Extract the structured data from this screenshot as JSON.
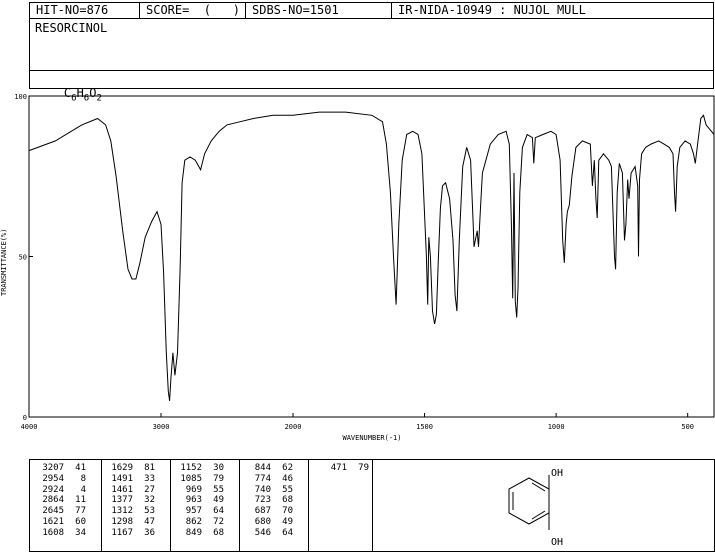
{
  "header": {
    "hit_no": "HIT-NO=876",
    "score": "SCORE=  (   )",
    "sdbs_no": "SDBS-NO=1501",
    "ir_nida": "IR-NIDA-10949 : NUJOL MULL"
  },
  "compound": {
    "name": "RESORCINOL",
    "formula": {
      "c": "C",
      "c_n": "6",
      "h": "H",
      "h_n": "6",
      "o": "O",
      "o_n": "2"
    }
  },
  "structure": {
    "oh_top": "OH",
    "oh_bottom": "OH"
  },
  "chart_data": {
    "type": "line",
    "title": "",
    "xlabel": "WAVENUMBER(-1)",
    "ylabel": "TRANSMITTANCE(%)",
    "xlim": [
      4000,
      400
    ],
    "ylim": [
      0,
      100
    ],
    "x_ticks": [
      "4000",
      "3000",
      "2000",
      "1500",
      "1000",
      "500"
    ],
    "y_ticks": [
      "100",
      "50",
      "0"
    ],
    "grid": false,
    "series": [
      {
        "name": "",
        "points": [
          [
            4000,
            83
          ],
          [
            3800,
            86
          ],
          [
            3600,
            91
          ],
          [
            3480,
            93
          ],
          [
            3420,
            91
          ],
          [
            3380,
            86
          ],
          [
            3340,
            75
          ],
          [
            3290,
            58
          ],
          [
            3250,
            46
          ],
          [
            3220,
            43
          ],
          [
            3190,
            43
          ],
          [
            3160,
            48
          ],
          [
            3120,
            56
          ],
          [
            3070,
            61
          ],
          [
            3030,
            64
          ],
          [
            3000,
            60
          ],
          [
            2980,
            45
          ],
          [
            2960,
            20
          ],
          [
            2945,
            8
          ],
          [
            2935,
            5
          ],
          [
            2925,
            12
          ],
          [
            2910,
            20
          ],
          [
            2895,
            13
          ],
          [
            2875,
            20
          ],
          [
            2855,
            46
          ],
          [
            2840,
            73
          ],
          [
            2820,
            80
          ],
          [
            2780,
            81
          ],
          [
            2740,
            80
          ],
          [
            2700,
            77
          ],
          [
            2670,
            82
          ],
          [
            2620,
            86
          ],
          [
            2560,
            89
          ],
          [
            2500,
            91
          ],
          [
            2400,
            92
          ],
          [
            2300,
            93
          ],
          [
            2150,
            94
          ],
          [
            2000,
            94
          ],
          [
            1900,
            95
          ],
          [
            1800,
            95
          ],
          [
            1700,
            94
          ],
          [
            1660,
            92
          ],
          [
            1645,
            85
          ],
          [
            1630,
            70
          ],
          [
            1618,
            50
          ],
          [
            1608,
            35
          ],
          [
            1598,
            60
          ],
          [
            1585,
            80
          ],
          [
            1568,
            88
          ],
          [
            1545,
            89
          ],
          [
            1525,
            88
          ],
          [
            1510,
            82
          ],
          [
            1493,
            50
          ],
          [
            1488,
            35
          ],
          [
            1484,
            56
          ],
          [
            1478,
            50
          ],
          [
            1470,
            33
          ],
          [
            1462,
            29
          ],
          [
            1455,
            32
          ],
          [
            1448,
            48
          ],
          [
            1440,
            65
          ],
          [
            1432,
            72
          ],
          [
            1420,
            73
          ],
          [
            1405,
            68
          ],
          [
            1392,
            55
          ],
          [
            1384,
            38
          ],
          [
            1377,
            33
          ],
          [
            1368,
            55
          ],
          [
            1355,
            78
          ],
          [
            1340,
            84
          ],
          [
            1325,
            80
          ],
          [
            1315,
            60
          ],
          [
            1312,
            53
          ],
          [
            1300,
            58
          ],
          [
            1295,
            53
          ],
          [
            1288,
            64
          ],
          [
            1280,
            76
          ],
          [
            1250,
            85
          ],
          [
            1220,
            88
          ],
          [
            1190,
            89
          ],
          [
            1178,
            85
          ],
          [
            1170,
            60
          ],
          [
            1165,
            37
          ],
          [
            1160,
            76
          ],
          [
            1155,
            36
          ],
          [
            1150,
            31
          ],
          [
            1145,
            40
          ],
          [
            1138,
            70
          ],
          [
            1128,
            84
          ],
          [
            1110,
            88
          ],
          [
            1090,
            87
          ],
          [
            1085,
            79
          ],
          [
            1079,
            87
          ],
          [
            1050,
            88
          ],
          [
            1020,
            89
          ],
          [
            1000,
            88
          ],
          [
            985,
            80
          ],
          [
            975,
            55
          ],
          [
            969,
            48
          ],
          [
            962,
            60
          ],
          [
            957,
            64
          ],
          [
            950,
            66
          ],
          [
            940,
            75
          ],
          [
            925,
            84
          ],
          [
            900,
            86
          ],
          [
            870,
            85
          ],
          [
            862,
            72
          ],
          [
            855,
            80
          ],
          [
            849,
            68
          ],
          [
            844,
            62
          ],
          [
            838,
            80
          ],
          [
            820,
            82
          ],
          [
            800,
            80
          ],
          [
            790,
            78
          ],
          [
            778,
            50
          ],
          [
            774,
            46
          ],
          [
            768,
            70
          ],
          [
            760,
            79
          ],
          [
            748,
            76
          ],
          [
            740,
            55
          ],
          [
            735,
            60
          ],
          [
            728,
            74
          ],
          [
            723,
            68
          ],
          [
            715,
            76
          ],
          [
            700,
            78
          ],
          [
            690,
            72
          ],
          [
            687,
            50
          ],
          [
            683,
            74
          ],
          [
            675,
            82
          ],
          [
            660,
            84
          ],
          [
            640,
            85
          ],
          [
            610,
            86
          ],
          [
            590,
            85
          ],
          [
            570,
            84
          ],
          [
            556,
            82
          ],
          [
            550,
            70
          ],
          [
            546,
            64
          ],
          [
            540,
            78
          ],
          [
            530,
            84
          ],
          [
            510,
            86
          ],
          [
            490,
            85
          ],
          [
            478,
            82
          ],
          [
            471,
            79
          ],
          [
            464,
            84
          ],
          [
            450,
            93
          ],
          [
            440,
            94
          ],
          [
            430,
            91
          ],
          [
            410,
            89
          ],
          [
            400,
            88
          ]
        ]
      }
    ]
  },
  "peak_table": [
    [
      [
        "3207",
        "41"
      ],
      [
        "2954",
        "8"
      ],
      [
        "2924",
        "4"
      ],
      [
        "2864",
        "11"
      ],
      [
        "2645",
        "77"
      ],
      [
        "1621",
        "60"
      ],
      [
        "1608",
        "34"
      ]
    ],
    [
      [
        "1629",
        "81"
      ],
      [
        "1491",
        "33"
      ],
      [
        "1461",
        "27"
      ],
      [
        "1377",
        "32"
      ],
      [
        "1312",
        "53"
      ],
      [
        "1298",
        "47"
      ],
      [
        "1167",
        "36"
      ]
    ],
    [
      [
        "1152",
        "30"
      ],
      [
        "1085",
        "79"
      ],
      [
        "969",
        "55"
      ],
      [
        "963",
        "49"
      ],
      [
        "957",
        "64"
      ],
      [
        "862",
        "72"
      ],
      [
        "849",
        "68"
      ]
    ],
    [
      [
        "844",
        "62"
      ],
      [
        "774",
        "46"
      ],
      [
        "740",
        "55"
      ],
      [
        "723",
        "68"
      ],
      [
        "687",
        "70"
      ],
      [
        "680",
        "49"
      ],
      [
        "546",
        "64"
      ]
    ],
    [
      [
        "471",
        "79"
      ]
    ]
  ]
}
